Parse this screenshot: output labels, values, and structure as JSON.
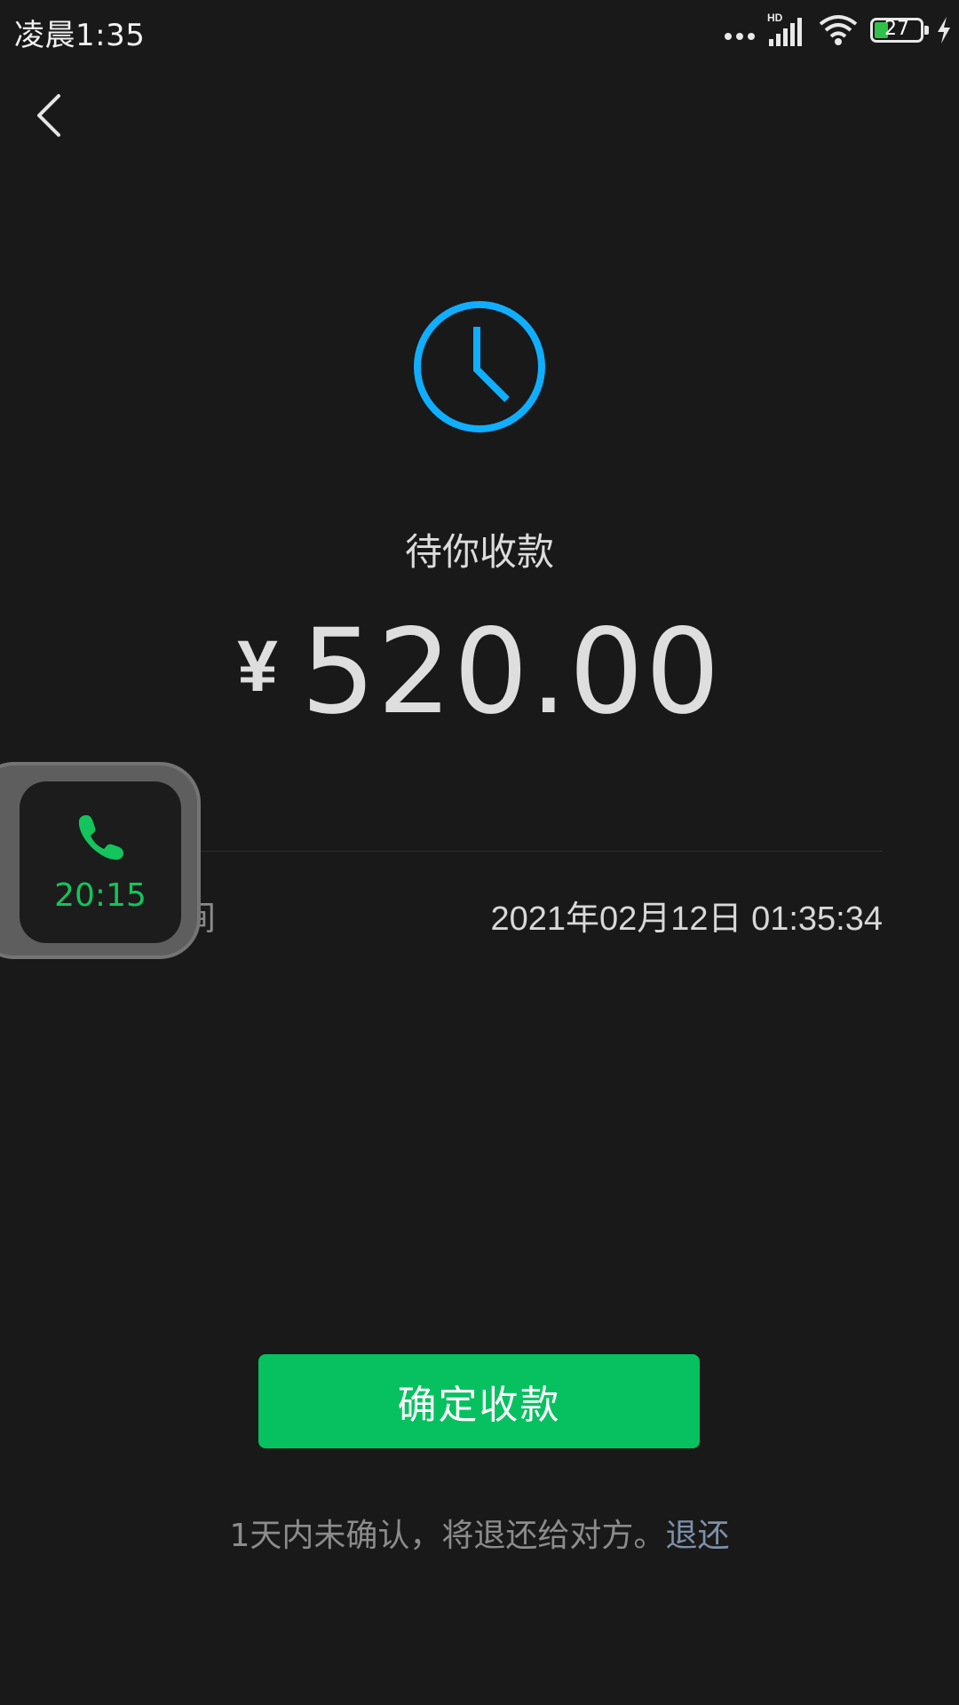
{
  "status_bar": {
    "time": "凌晨1:35",
    "network": "HD",
    "battery_level": "27",
    "battery_fraction": 0.27
  },
  "navigation": {
    "back_icon": "chevron-left-icon"
  },
  "transfer": {
    "status_icon": "clock-icon",
    "status_color": "#10aeff",
    "status_title": "待你收款",
    "currency_symbol": "¥",
    "amount": "520.00",
    "detail_label": "间",
    "detail_value": "2021年02月12日 01:35:34"
  },
  "floating_call": {
    "icon": "phone-icon",
    "duration": "20:15",
    "color": "#14c45c"
  },
  "actions": {
    "confirm_label": "确定收款",
    "confirm_color": "#07c160"
  },
  "footer": {
    "note": "1天内未确认，将退还给对方。",
    "refund_link": "退还"
  }
}
